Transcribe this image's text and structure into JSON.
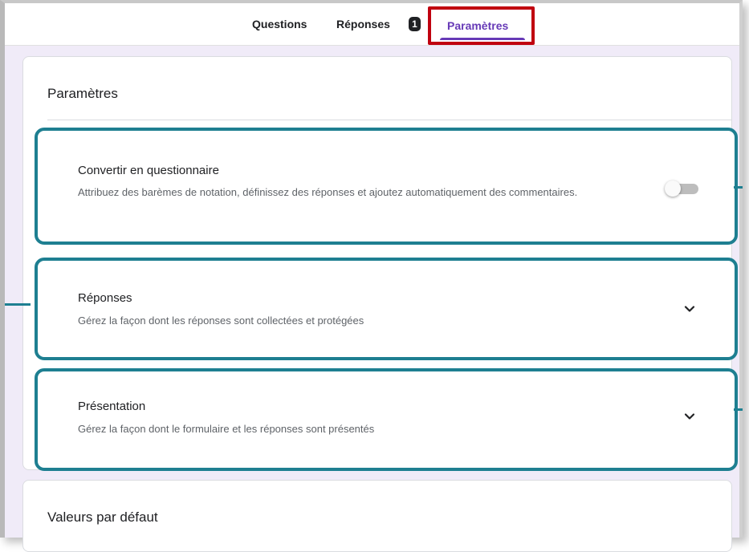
{
  "tabs": {
    "questions": "Questions",
    "reponses": "Réponses",
    "reponses_badge": "1",
    "parametres": "Paramètres"
  },
  "settings_card": {
    "title": "Paramètres",
    "quiz": {
      "title": "Convertir en questionnaire",
      "description": "Attribuez des barèmes de notation, définissez des réponses et ajoutez automatiquement des commentaires.",
      "toggle_on": false
    },
    "responses": {
      "title": "Réponses",
      "description": "Gérez la façon dont les réponses sont collectées et protégées"
    },
    "presentation": {
      "title": "Présentation",
      "description": "Gérez la façon dont le formulaire et les réponses sont présentés"
    }
  },
  "defaults_card": {
    "title": "Valeurs par défaut"
  },
  "colors": {
    "accent": "#673ab7",
    "highlight_red": "#c0000f",
    "highlight_teal": "#1e7f91",
    "background": "#f0ebf8"
  },
  "icons": {
    "toggle": "toggle-switch",
    "expand": "chevron-down-icon"
  }
}
